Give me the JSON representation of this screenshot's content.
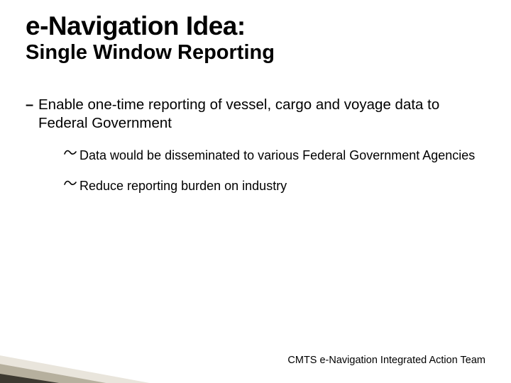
{
  "title_main": "e-Navigation Idea:",
  "title_sub": "Single Window Reporting",
  "bullets": {
    "level1": {
      "text": "Enable one-time reporting of vessel, cargo and voyage data to Federal Government"
    },
    "level2": [
      {
        "text": "Data would be disseminated to various Federal Government Agencies"
      },
      {
        "text": "Reduce reporting burden on industry"
      }
    ]
  },
  "footer": "CMTS e-Navigation Integrated Action Team",
  "icons": {
    "dash": "–"
  }
}
